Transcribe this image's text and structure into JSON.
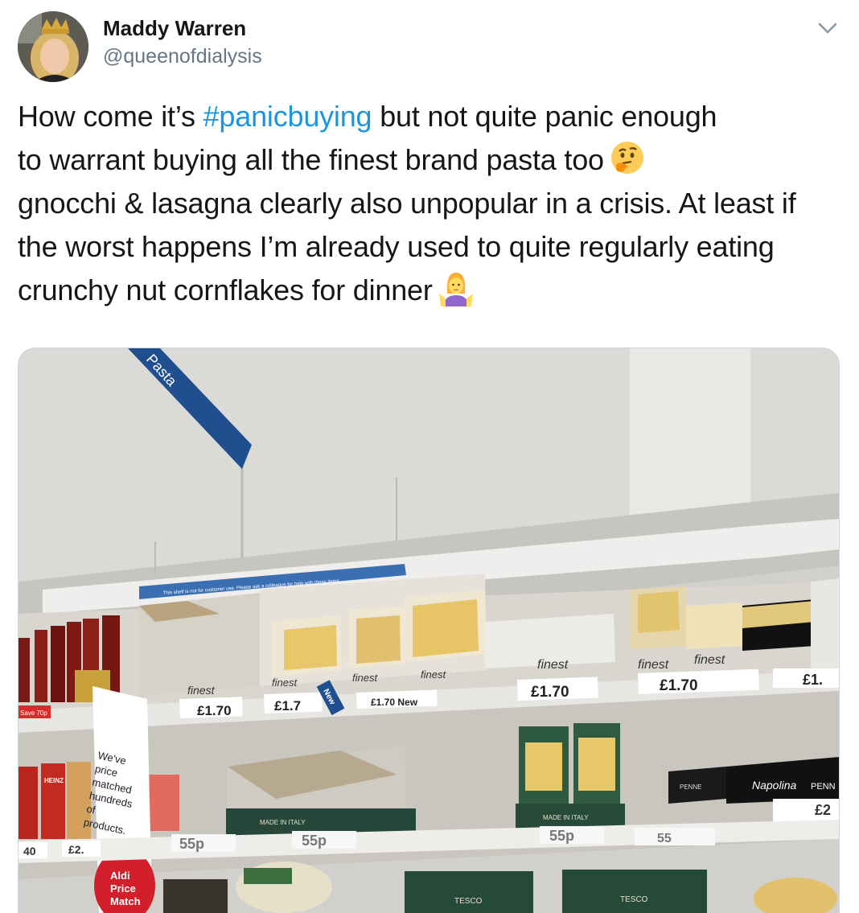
{
  "author": {
    "name": "Maddy Warren",
    "handle": "@queenofdialysis"
  },
  "tweet": {
    "text_line1_a": "How come it’s ",
    "hashtag": "#panicbuying",
    "text_line1_b": " but not quite panic enough",
    "text_line2": "to warrant buying all the finest brand pasta too",
    "text_rest": "gnocchi & lasagna clearly also unpopular in a crisis. At least if the worst happens I’m already used to quite regularly eating crunchy nut cornflakes for dinner",
    "emoji_1": "thinking-face-emoji",
    "emoji_2": "woman-shrugging-emoji"
  },
  "photo": {
    "aisle_sign": "Pasta",
    "shelf_notice": "This shelf is not for customer use. Please ask a colleague for help with these items.",
    "brand_finest": "finest",
    "brand_tesco": "TESCO",
    "price_170": "£1.70",
    "price_170_new": "£1.70 New",
    "price_17_partial": "£1.7",
    "price_1_partial": "£1.",
    "price_55p": "55p",
    "price_55_partial": "55",
    "price_2_partial": "£2",
    "price_2_partial_b": "£2.",
    "price_40_partial": "40",
    "new_badge": "New",
    "price_match_sign": "We've price matched hundreds of products.",
    "aldi_badge": "Aldi Price Match",
    "made_in_italy": "MADE IN ITALY",
    "napolina": "Napolina",
    "penne": "PENN",
    "penne_small": "PENNE",
    "save_tag": "Save 70p",
    "heinz": "HEINZ"
  }
}
